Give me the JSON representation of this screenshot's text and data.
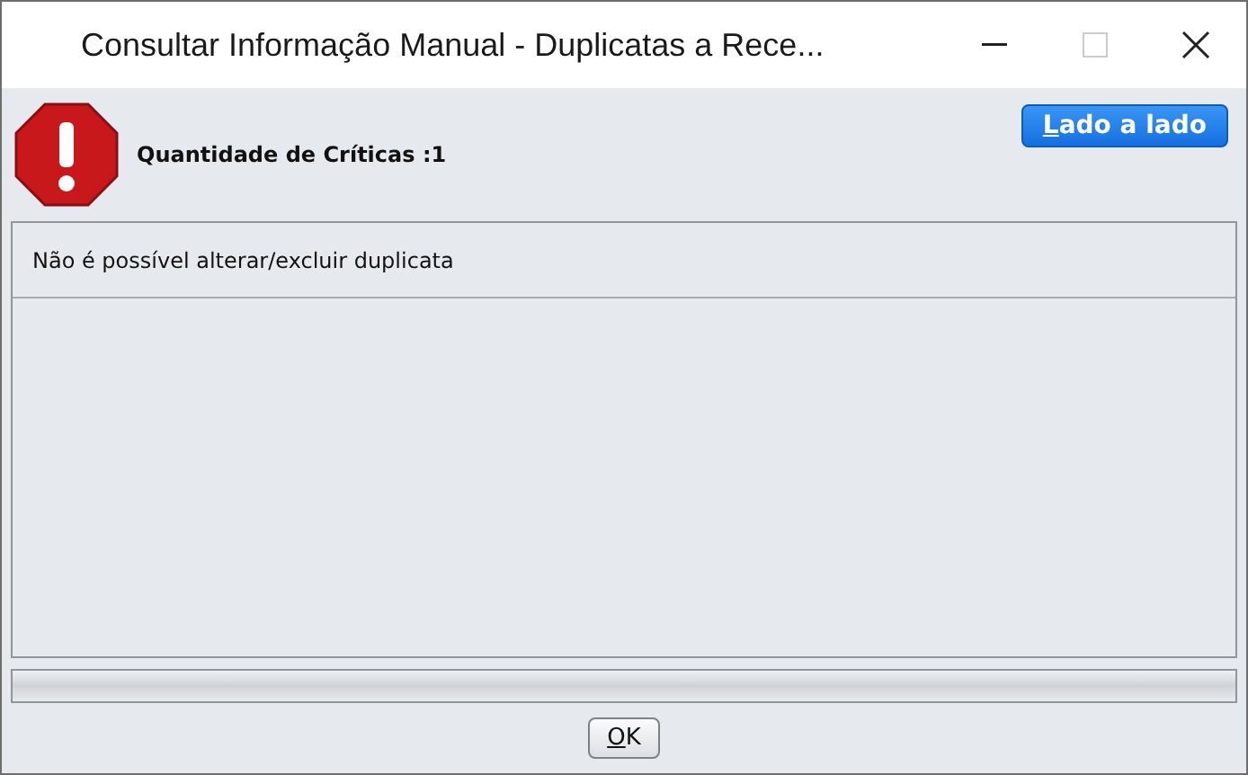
{
  "window": {
    "title": "Consultar Informação Manual - Duplicatas a Rece..."
  },
  "header": {
    "critics_label": "Quantidade de Críticas :1",
    "side_button": "Lado a lado"
  },
  "messages": [
    "Não é possível alterar/excluir duplicata"
  ],
  "buttons": [
    "OK"
  ]
}
